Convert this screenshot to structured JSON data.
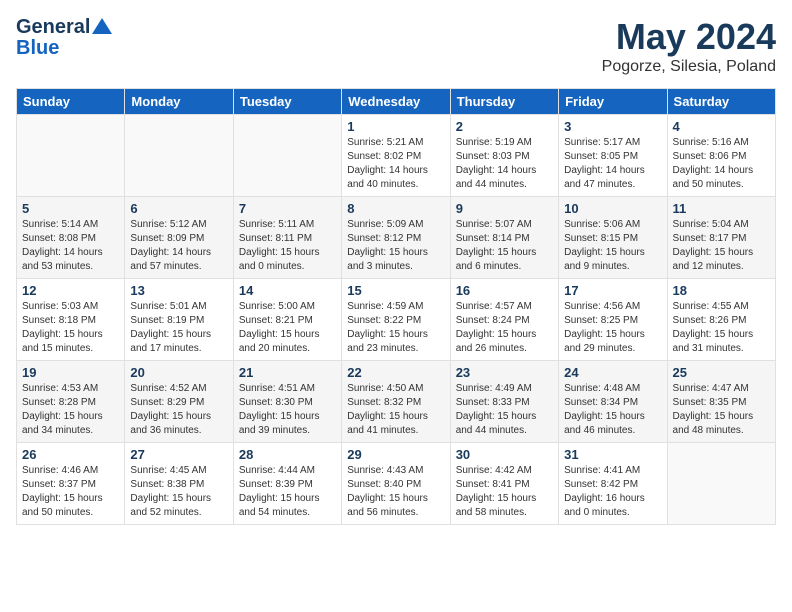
{
  "header": {
    "logo_line1": "General",
    "logo_line2": "Blue",
    "title": "May 2024",
    "subtitle": "Pogorze, Silesia, Poland"
  },
  "weekdays": [
    "Sunday",
    "Monday",
    "Tuesday",
    "Wednesday",
    "Thursday",
    "Friday",
    "Saturday"
  ],
  "weeks": [
    [
      {
        "day": "",
        "info": ""
      },
      {
        "day": "",
        "info": ""
      },
      {
        "day": "",
        "info": ""
      },
      {
        "day": "1",
        "info": "Sunrise: 5:21 AM\nSunset: 8:02 PM\nDaylight: 14 hours\nand 40 minutes."
      },
      {
        "day": "2",
        "info": "Sunrise: 5:19 AM\nSunset: 8:03 PM\nDaylight: 14 hours\nand 44 minutes."
      },
      {
        "day": "3",
        "info": "Sunrise: 5:17 AM\nSunset: 8:05 PM\nDaylight: 14 hours\nand 47 minutes."
      },
      {
        "day": "4",
        "info": "Sunrise: 5:16 AM\nSunset: 8:06 PM\nDaylight: 14 hours\nand 50 minutes."
      }
    ],
    [
      {
        "day": "5",
        "info": "Sunrise: 5:14 AM\nSunset: 8:08 PM\nDaylight: 14 hours\nand 53 minutes."
      },
      {
        "day": "6",
        "info": "Sunrise: 5:12 AM\nSunset: 8:09 PM\nDaylight: 14 hours\nand 57 minutes."
      },
      {
        "day": "7",
        "info": "Sunrise: 5:11 AM\nSunset: 8:11 PM\nDaylight: 15 hours\nand 0 minutes."
      },
      {
        "day": "8",
        "info": "Sunrise: 5:09 AM\nSunset: 8:12 PM\nDaylight: 15 hours\nand 3 minutes."
      },
      {
        "day": "9",
        "info": "Sunrise: 5:07 AM\nSunset: 8:14 PM\nDaylight: 15 hours\nand 6 minutes."
      },
      {
        "day": "10",
        "info": "Sunrise: 5:06 AM\nSunset: 8:15 PM\nDaylight: 15 hours\nand 9 minutes."
      },
      {
        "day": "11",
        "info": "Sunrise: 5:04 AM\nSunset: 8:17 PM\nDaylight: 15 hours\nand 12 minutes."
      }
    ],
    [
      {
        "day": "12",
        "info": "Sunrise: 5:03 AM\nSunset: 8:18 PM\nDaylight: 15 hours\nand 15 minutes."
      },
      {
        "day": "13",
        "info": "Sunrise: 5:01 AM\nSunset: 8:19 PM\nDaylight: 15 hours\nand 17 minutes."
      },
      {
        "day": "14",
        "info": "Sunrise: 5:00 AM\nSunset: 8:21 PM\nDaylight: 15 hours\nand 20 minutes."
      },
      {
        "day": "15",
        "info": "Sunrise: 4:59 AM\nSunset: 8:22 PM\nDaylight: 15 hours\nand 23 minutes."
      },
      {
        "day": "16",
        "info": "Sunrise: 4:57 AM\nSunset: 8:24 PM\nDaylight: 15 hours\nand 26 minutes."
      },
      {
        "day": "17",
        "info": "Sunrise: 4:56 AM\nSunset: 8:25 PM\nDaylight: 15 hours\nand 29 minutes."
      },
      {
        "day": "18",
        "info": "Sunrise: 4:55 AM\nSunset: 8:26 PM\nDaylight: 15 hours\nand 31 minutes."
      }
    ],
    [
      {
        "day": "19",
        "info": "Sunrise: 4:53 AM\nSunset: 8:28 PM\nDaylight: 15 hours\nand 34 minutes."
      },
      {
        "day": "20",
        "info": "Sunrise: 4:52 AM\nSunset: 8:29 PM\nDaylight: 15 hours\nand 36 minutes."
      },
      {
        "day": "21",
        "info": "Sunrise: 4:51 AM\nSunset: 8:30 PM\nDaylight: 15 hours\nand 39 minutes."
      },
      {
        "day": "22",
        "info": "Sunrise: 4:50 AM\nSunset: 8:32 PM\nDaylight: 15 hours\nand 41 minutes."
      },
      {
        "day": "23",
        "info": "Sunrise: 4:49 AM\nSunset: 8:33 PM\nDaylight: 15 hours\nand 44 minutes."
      },
      {
        "day": "24",
        "info": "Sunrise: 4:48 AM\nSunset: 8:34 PM\nDaylight: 15 hours\nand 46 minutes."
      },
      {
        "day": "25",
        "info": "Sunrise: 4:47 AM\nSunset: 8:35 PM\nDaylight: 15 hours\nand 48 minutes."
      }
    ],
    [
      {
        "day": "26",
        "info": "Sunrise: 4:46 AM\nSunset: 8:37 PM\nDaylight: 15 hours\nand 50 minutes."
      },
      {
        "day": "27",
        "info": "Sunrise: 4:45 AM\nSunset: 8:38 PM\nDaylight: 15 hours\nand 52 minutes."
      },
      {
        "day": "28",
        "info": "Sunrise: 4:44 AM\nSunset: 8:39 PM\nDaylight: 15 hours\nand 54 minutes."
      },
      {
        "day": "29",
        "info": "Sunrise: 4:43 AM\nSunset: 8:40 PM\nDaylight: 15 hours\nand 56 minutes."
      },
      {
        "day": "30",
        "info": "Sunrise: 4:42 AM\nSunset: 8:41 PM\nDaylight: 15 hours\nand 58 minutes."
      },
      {
        "day": "31",
        "info": "Sunrise: 4:41 AM\nSunset: 8:42 PM\nDaylight: 16 hours\nand 0 minutes."
      },
      {
        "day": "",
        "info": ""
      }
    ]
  ]
}
